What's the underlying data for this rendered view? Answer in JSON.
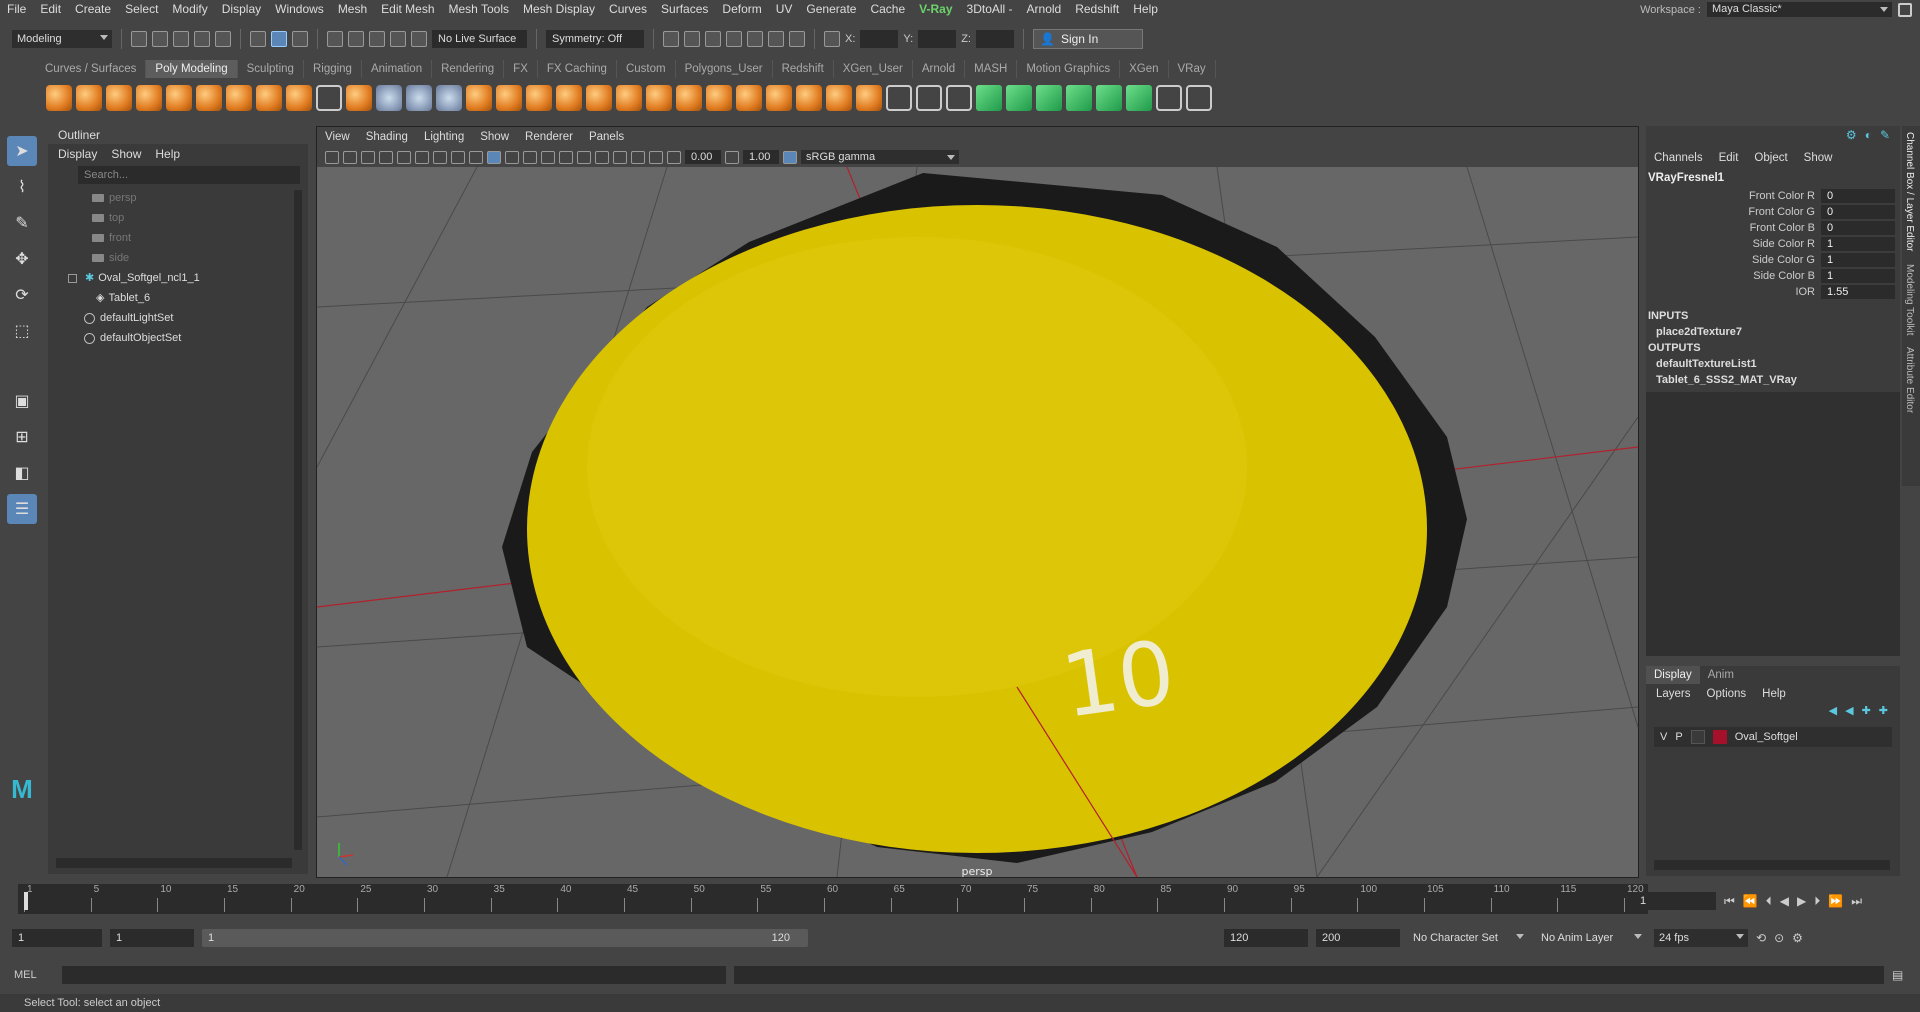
{
  "menubar": [
    "File",
    "Edit",
    "Create",
    "Select",
    "Modify",
    "Display",
    "Windows",
    "Mesh",
    "Edit Mesh",
    "Mesh Tools",
    "Mesh Display",
    "Curves",
    "Surfaces",
    "Deform",
    "UV",
    "Generate",
    "Cache",
    "V-Ray",
    "3DtoAll -",
    "Arnold",
    "Redshift",
    "Help"
  ],
  "workspace": {
    "label": "Workspace :",
    "value": "Maya Classic*"
  },
  "statusline": {
    "mode": "Modeling",
    "live_surface": "No Live Surface",
    "symmetry": "Symmetry: Off",
    "x_label": "X:",
    "y_label": "Y:",
    "z_label": "Z:",
    "sign_in": "Sign In"
  },
  "shelf_tabs": [
    "Curves / Surfaces",
    "Poly Modeling",
    "Sculpting",
    "Rigging",
    "Animation",
    "Rendering",
    "FX",
    "FX Caching",
    "Custom",
    "Polygons_User",
    "Redshift",
    "XGen_User",
    "Arnold",
    "MASH",
    "Motion Graphics",
    "XGen",
    "VRay"
  ],
  "outliner": {
    "title": "Outliner",
    "menu": [
      "Display",
      "Show",
      "Help"
    ],
    "search_placeholder": "Search...",
    "items": [
      {
        "label": "persp",
        "type": "camera"
      },
      {
        "label": "top",
        "type": "camera"
      },
      {
        "label": "front",
        "type": "camera"
      },
      {
        "label": "side",
        "type": "camera"
      },
      {
        "label": "Oval_Softgel_ncl1_1",
        "type": "group"
      },
      {
        "label": "Tablet_6",
        "type": "mesh"
      },
      {
        "label": "defaultLightSet",
        "type": "set"
      },
      {
        "label": "defaultObjectSet",
        "type": "set"
      }
    ]
  },
  "viewport": {
    "menu": [
      "View",
      "Shading",
      "Lighting",
      "Show",
      "Renderer",
      "Panels"
    ],
    "exposure": "0.00",
    "gamma": "1.00",
    "color_space": "sRGB gamma",
    "camera_label": "persp",
    "tablet_text": "10",
    "colors": {
      "tablet": "#d9c200",
      "grid_bg": "#676767",
      "axis": "#b3202d"
    }
  },
  "channelbox": {
    "menu": [
      "Channels",
      "Edit",
      "Object",
      "Show"
    ],
    "node": "VRayFresnel1",
    "attributes": [
      {
        "label": "Front Color R",
        "value": "0"
      },
      {
        "label": "Front Color G",
        "value": "0"
      },
      {
        "label": "Front Color B",
        "value": "0"
      },
      {
        "label": "Side Color R",
        "value": "1"
      },
      {
        "label": "Side Color G",
        "value": "1"
      },
      {
        "label": "Side Color B",
        "value": "1"
      },
      {
        "label": "IOR",
        "value": "1.55"
      }
    ],
    "inputs_label": "INPUTS",
    "inputs": [
      "place2dTexture7"
    ],
    "outputs_label": "OUTPUTS",
    "outputs": [
      "defaultTextureList1",
      "Tablet_6_SSS2_MAT_VRay"
    ]
  },
  "side_tabs": [
    "Channel Box / Layer Editor",
    "Modeling Toolkit",
    "Attribute Editor"
  ],
  "layers": {
    "tabs": [
      "Display",
      "Anim"
    ],
    "menu": [
      "Layers",
      "Options",
      "Help"
    ],
    "row": {
      "v": "V",
      "p": "P",
      "name": "Oval_Softgel",
      "color": "#a5102a"
    }
  },
  "timeline": {
    "ticks": [
      "1",
      "5",
      "10",
      "15",
      "20",
      "25",
      "30",
      "35",
      "40",
      "45",
      "50",
      "55",
      "60",
      "65",
      "70",
      "75",
      "80",
      "85",
      "90",
      "95",
      "100",
      "105",
      "110",
      "115",
      "120"
    ],
    "current_frame": "1"
  },
  "range": {
    "start": "1",
    "playback_start": "1",
    "slider_start": "1",
    "slider_end": "120",
    "playback_end": "120",
    "end": "200",
    "character_set": "No Character Set",
    "anim_layer": "No Anim Layer",
    "fps": "24 fps"
  },
  "cmdline": {
    "label": "MEL"
  },
  "helpline": "Select Tool: select an object"
}
